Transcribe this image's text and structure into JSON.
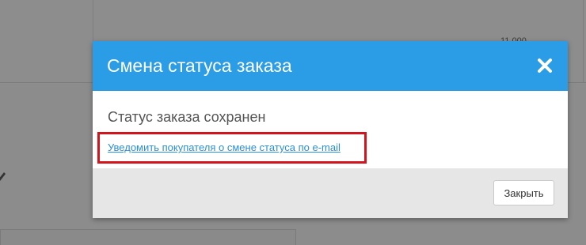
{
  "background": {
    "partial_number": "11 000"
  },
  "modal": {
    "title": "Смена статуса заказа",
    "close_icon": "close-icon",
    "status_text": "Статус заказа сохранен",
    "notify_link": "Уведомить покупателя о смене статуса по e-mail",
    "close_button_label": "Закрыть"
  },
  "colors": {
    "header_bg": "#2b9ce6",
    "link": "#2b8fd6",
    "highlight": "#d4141c",
    "footer_bg": "#e6e6e6"
  }
}
